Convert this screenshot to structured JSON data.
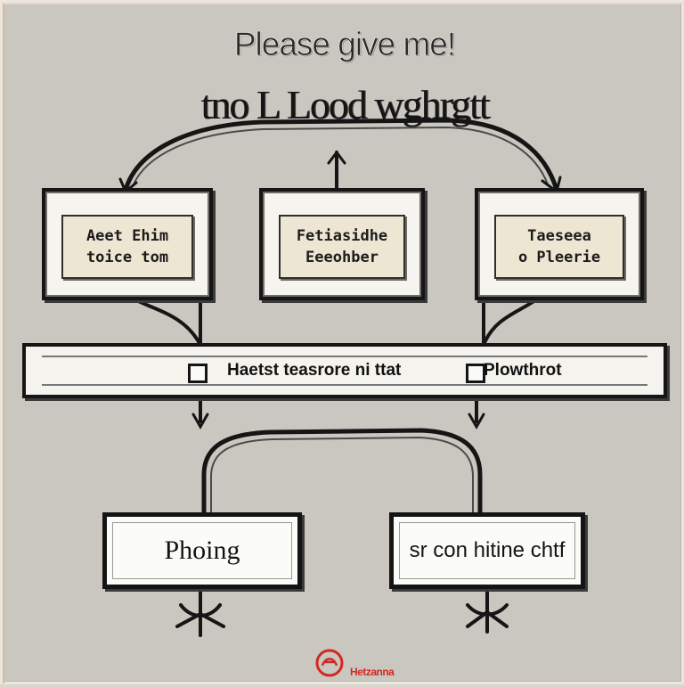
{
  "title": {
    "line1": "Please give me!",
    "line2": "tno L Lood wghrgtt"
  },
  "nodes": [
    {
      "lines": [
        "Aeet Ehim",
        "toice tom"
      ]
    },
    {
      "lines": [
        "Fetiasidhe",
        "Eeeohber"
      ]
    },
    {
      "lines": [
        "Taeseea",
        "o Pleerie"
      ]
    }
  ],
  "bar": {
    "left_label": "Haetst teasrore ni ttat",
    "right_label": "Plowthrot"
  },
  "outputs": {
    "left": "Phoing",
    "right": "sr con hitine chtf"
  },
  "watermark": {
    "text": "Hetzanna"
  },
  "colors": {
    "background": "#c9c7bf",
    "ink": "#151515",
    "panel": "#f5f4ef",
    "label_panel": "#ede6d2",
    "watermark": "#d02a22"
  }
}
